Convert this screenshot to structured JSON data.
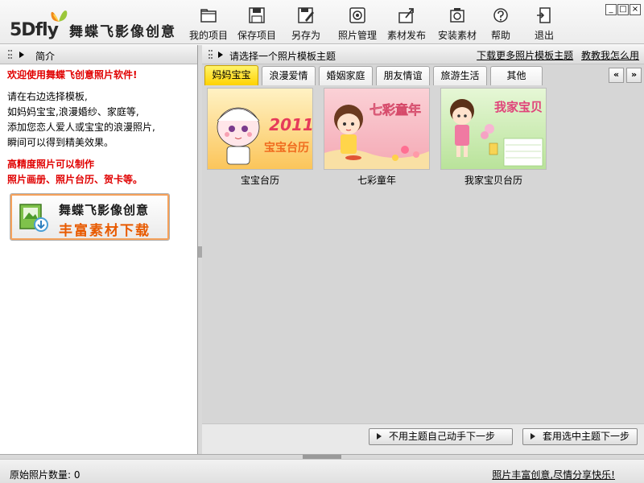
{
  "app": {
    "logo_text": "5Dfly",
    "logo_cn": "舞蝶飞影像创意"
  },
  "toolbar": [
    {
      "label": "我的项目",
      "icon": "folder-icon"
    },
    {
      "label": "保存项目",
      "icon": "floppy-disk-icon"
    },
    {
      "label": "另存为",
      "icon": "save-as-icon"
    },
    {
      "label": "照片管理",
      "icon": "camera-icon"
    },
    {
      "label": "素材发布",
      "icon": "upload-icon"
    },
    {
      "label": "安装素材",
      "icon": "install-package-icon"
    },
    {
      "label": "帮助",
      "icon": "help-icon"
    },
    {
      "label": "退出",
      "icon": "exit-door-icon"
    }
  ],
  "left_panel": {
    "title": "简介",
    "welcome": "欢迎使用舞蝶飞创意照片软件!",
    "body_lines": [
      "请在右边选择模板,",
      "如妈妈宝宝,浪漫婚纱、家庭等,",
      "添加您恋人爱人或宝宝的浪漫照片,",
      "瞬间可以得到精美效果。"
    ],
    "highlight_lines": [
      "高精度照片可以制作",
      "照片画册、照片台历、贺卡等。"
    ],
    "promo": {
      "line1": "舞蝶飞影像创意",
      "line2": "丰富素材下载"
    }
  },
  "right_panel": {
    "title": "请选择一个照片模板主题",
    "links": [
      "下载更多照片模板主题",
      "教教我怎么用"
    ],
    "tabs": [
      "妈妈宝宝",
      "浪漫爱情",
      "婚姻家庭",
      "朋友情谊",
      "旅游生活",
      "其他"
    ],
    "active_tab": "妈妈宝宝",
    "tab_prev": "«",
    "tab_next": "»",
    "thumbnails": [
      {
        "caption": "宝宝台历",
        "image_text": "2011",
        "image_subtext": "宝宝台历"
      },
      {
        "caption": "七彩童年",
        "image_text": "七彩童年"
      },
      {
        "caption": "我家宝贝台历",
        "image_text": "我家宝贝"
      }
    ],
    "buttons": {
      "no_theme": "不用主题自己动手下一步",
      "use_theme": "套用选中主题下一步"
    }
  },
  "status": {
    "photo_count": "原始照片数量: 0",
    "slogan": "照片丰富创意,尽情分享快乐!"
  },
  "colors": {
    "active_tab": "#ffd200",
    "highlight_red": "#e00000",
    "promo_orange": "#e85a00"
  }
}
